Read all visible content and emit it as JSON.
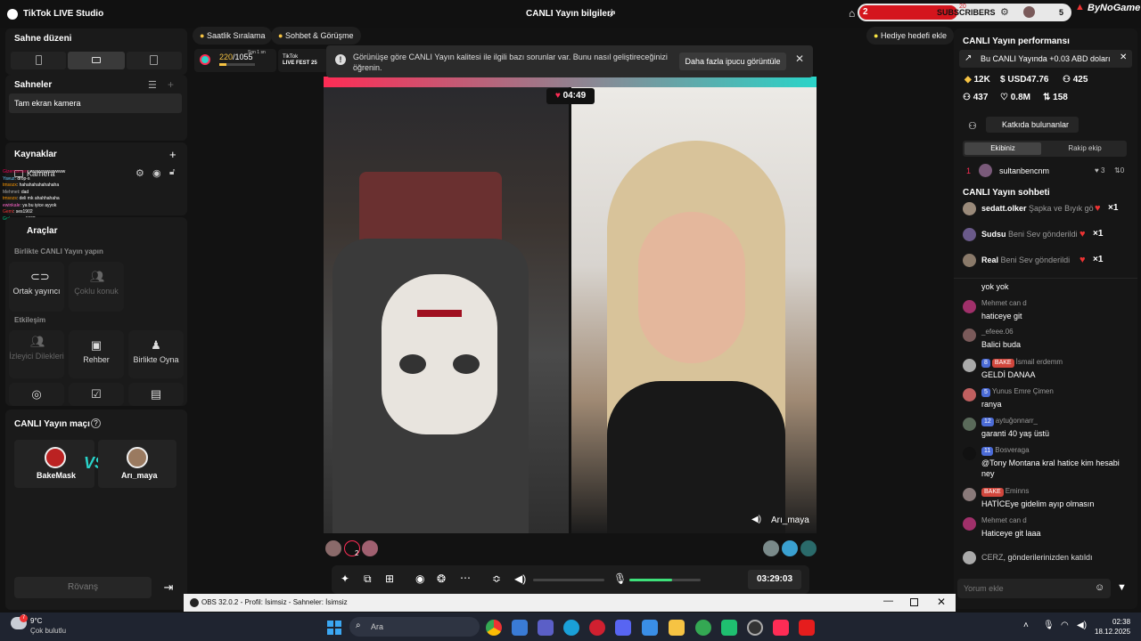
{
  "app": {
    "title": "TikTok LIVE Studio",
    "center_title": "CANLI Yayın bilgileri"
  },
  "overlay": {
    "subs_count": "2",
    "subs_label": "SUBSCRIBERS",
    "subs_top": "20",
    "subs_right": "5",
    "brand": "ByNoGame"
  },
  "left": {
    "scene_title": "Sahne düzeni",
    "scenes_title": "Sahneler",
    "scene_item": "Tam ekran kamera",
    "sources_title": "Kaynaklar",
    "source_item": "Kamera",
    "tools_title": "Araçlar",
    "together_title": "Birlikte CANLI Yayın yapın",
    "cohost": "Ortak yayıncı",
    "multiguest": "Çoklu konuk",
    "interaction_title": "Etkileşim",
    "viewer_requests": "İzleyici Dilekleri",
    "guide": "Rehber",
    "play_together": "Birlikte Oyna",
    "match_title": "CANLI Yayın maçı",
    "player1": "BakeMask",
    "player2": "Arı_maya",
    "vs": "VS",
    "rematch": "Rövanş",
    "source_chat": [
      {
        "u": "Gizemseven",
        "t": "wwwwwwwwwww"
      },
      {
        "u": "Yavuz",
        "t": "drop-s"
      },
      {
        "u": "tmsozx",
        "t": "hahahahahahahaha"
      },
      {
        "u": "Mehmet",
        "t": "dad"
      },
      {
        "u": "tmsozs",
        "t": "deli mk ahahhahaha"
      },
      {
        "u": "ewinkale",
        "t": "ya bu iyice ayyok"
      },
      {
        "u": "Gemi",
        "t": "ses1902"
      },
      {
        "u": "Gıdıpa",
        "t": "ses1902"
      }
    ]
  },
  "stage": {
    "pill_hourly": "Saatlik Sıralama",
    "pill_chat": "Sohbet & Görüşme",
    "goal_current": "220",
    "goal_total": "/1055",
    "goal_time": "Son 1 sn",
    "fest_label1": "TikTok",
    "fest_label2": "LIVE FEST 25",
    "warning_text": "Görünüşe göre CANLI Yayın kalitesi ile ilgili bazı sorunlar var. Bunu nasıl geliştireceğinizi öğrenin.",
    "warning_button": "Daha fazla ipucu görüntüle",
    "gift_goal": "Hediye hedefi ekle",
    "timer": "04:49",
    "right_name": "Arı_maya",
    "bottom_left_count": "2",
    "duration": "03:29:03",
    "mic_level": 0.6
  },
  "right": {
    "perf_title": "CANLI Yayın performansı",
    "banner": "Bu CANLI Yayında +0.03 ABD doları",
    "stat_coins": "12K",
    "stat_usd": "USD47.76",
    "stat_viewers": "425",
    "stat_followers": "437",
    "stat_likes": "0.8M",
    "stat_shares": "158",
    "contributors": "Katkıda bulunanlar",
    "tab_team": "Ekibiniz",
    "tab_rival": "Rakip ekip",
    "rank": "1",
    "top_user": "sultanbencnm",
    "top_hearts": "3",
    "top_count": "0",
    "chat_title": "CANLI Yayın sohbeti",
    "gifts": [
      {
        "user": "sedatt.olker",
        "text": "Şapka ve Bıyık gö",
        "count": "×1"
      },
      {
        "user": "Sudsu",
        "text": "Beni Sev gönderildi",
        "count": "×1"
      },
      {
        "user": "Real",
        "text": "Beni Sev gönderildi",
        "count": "×1"
      }
    ],
    "partial_msg": "yok yok",
    "messages": [
      {
        "user": "Mehmet can d",
        "text": "haticeye git",
        "level": "",
        "badge": ""
      },
      {
        "user": "_efeee.06",
        "text": "Balici buda",
        "level": "",
        "badge": ""
      },
      {
        "user": "İsmail erdemm",
        "text": "GELDİ DANAA",
        "level": "8",
        "badge": "BAKE"
      },
      {
        "user": "Yunus Emre Çimen",
        "text": "ranya",
        "level": "5",
        "badge": ""
      },
      {
        "user": "aytuğonnarr_",
        "text": "garanti 40 yaş üstü",
        "level": "12",
        "badge": ""
      },
      {
        "user": "Bosveraga",
        "text": "@Tony Montana kral hatice kim hesabi ney",
        "level": "11",
        "badge": ""
      },
      {
        "user": "Eminns",
        "text": "HATİCEye gidelim ayıp olmasın",
        "level": "",
        "badge": "BAKE"
      },
      {
        "user": "Mehmet can d",
        "text": "Haticeye git laaa",
        "level": "",
        "badge": ""
      }
    ],
    "joined_user": "CERZ",
    "joined_text": ", gönderilerinizden katıldı",
    "comment_placeholder": "Yorum ekle"
  },
  "obs": {
    "title": "OBS 32.0.2 - Profil: İsimsiz - Sahneler: İsimsiz"
  },
  "taskbar": {
    "temp": "9°C",
    "weather": "Çok bulutlu",
    "weather_badge": "7",
    "search": "Ara",
    "time": "02:38",
    "date": "18.12.2025"
  },
  "colors": {
    "accent": "#2ad4c8",
    "tiktok_pink": "#fe2c55",
    "mic_green": "#3ee07a",
    "bg": "#121212",
    "panel": "#1a1a1a"
  }
}
